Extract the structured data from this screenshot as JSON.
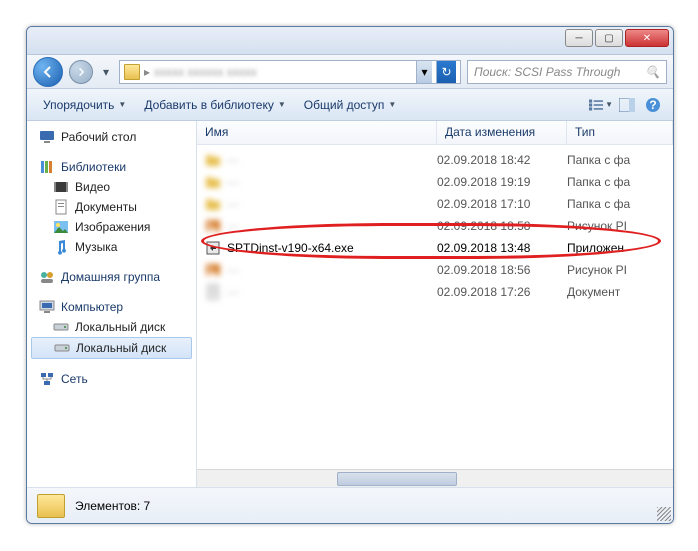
{
  "search": {
    "placeholder": "Поиск: SCSI Pass Through"
  },
  "toolbar": {
    "organize": "Упорядочить",
    "add_library": "Добавить в библиотеку",
    "share": "Общий доступ"
  },
  "sidebar": {
    "desktop": "Рабочий стол",
    "libraries": "Библиотеки",
    "video": "Видео",
    "documents": "Документы",
    "pictures": "Изображения",
    "music": "Музыка",
    "homegroup": "Домашняя группа",
    "computer": "Компьютер",
    "local_disk_a": "Локальный диск",
    "local_disk_b": "Локальный диск",
    "network": "Сеть"
  },
  "columns": {
    "name": "Имя",
    "date": "Дата изменения",
    "type": "Тип"
  },
  "rows": [
    {
      "name": "—",
      "date": "02.09.2018 18:42",
      "type": "Папка с фа",
      "blur": true,
      "icon": "folder"
    },
    {
      "name": "—",
      "date": "02.09.2018 19:19",
      "type": "Папка с фа",
      "blur": true,
      "icon": "folder"
    },
    {
      "name": "—",
      "date": "02.09.2018 17:10",
      "type": "Папка с фа",
      "blur": true,
      "icon": "folder"
    },
    {
      "name": "—",
      "date": "02.09.2018 18:58",
      "type": "Рисунок PI",
      "blur": true,
      "icon": "image"
    },
    {
      "name": "SPTDinst-v190-x64.exe",
      "date": "02.09.2018 13:48",
      "type": "Приложен",
      "blur": false,
      "icon": "exe"
    },
    {
      "name": "—",
      "date": "02.09.2018 18:56",
      "type": "Рисунок PI",
      "blur": true,
      "icon": "image"
    },
    {
      "name": "—",
      "date": "02.09.2018 17:26",
      "type": "Документ",
      "blur": true,
      "icon": "doc"
    }
  ],
  "status": {
    "count_label": "Элементов: 7"
  },
  "highlight_row_index": 4
}
